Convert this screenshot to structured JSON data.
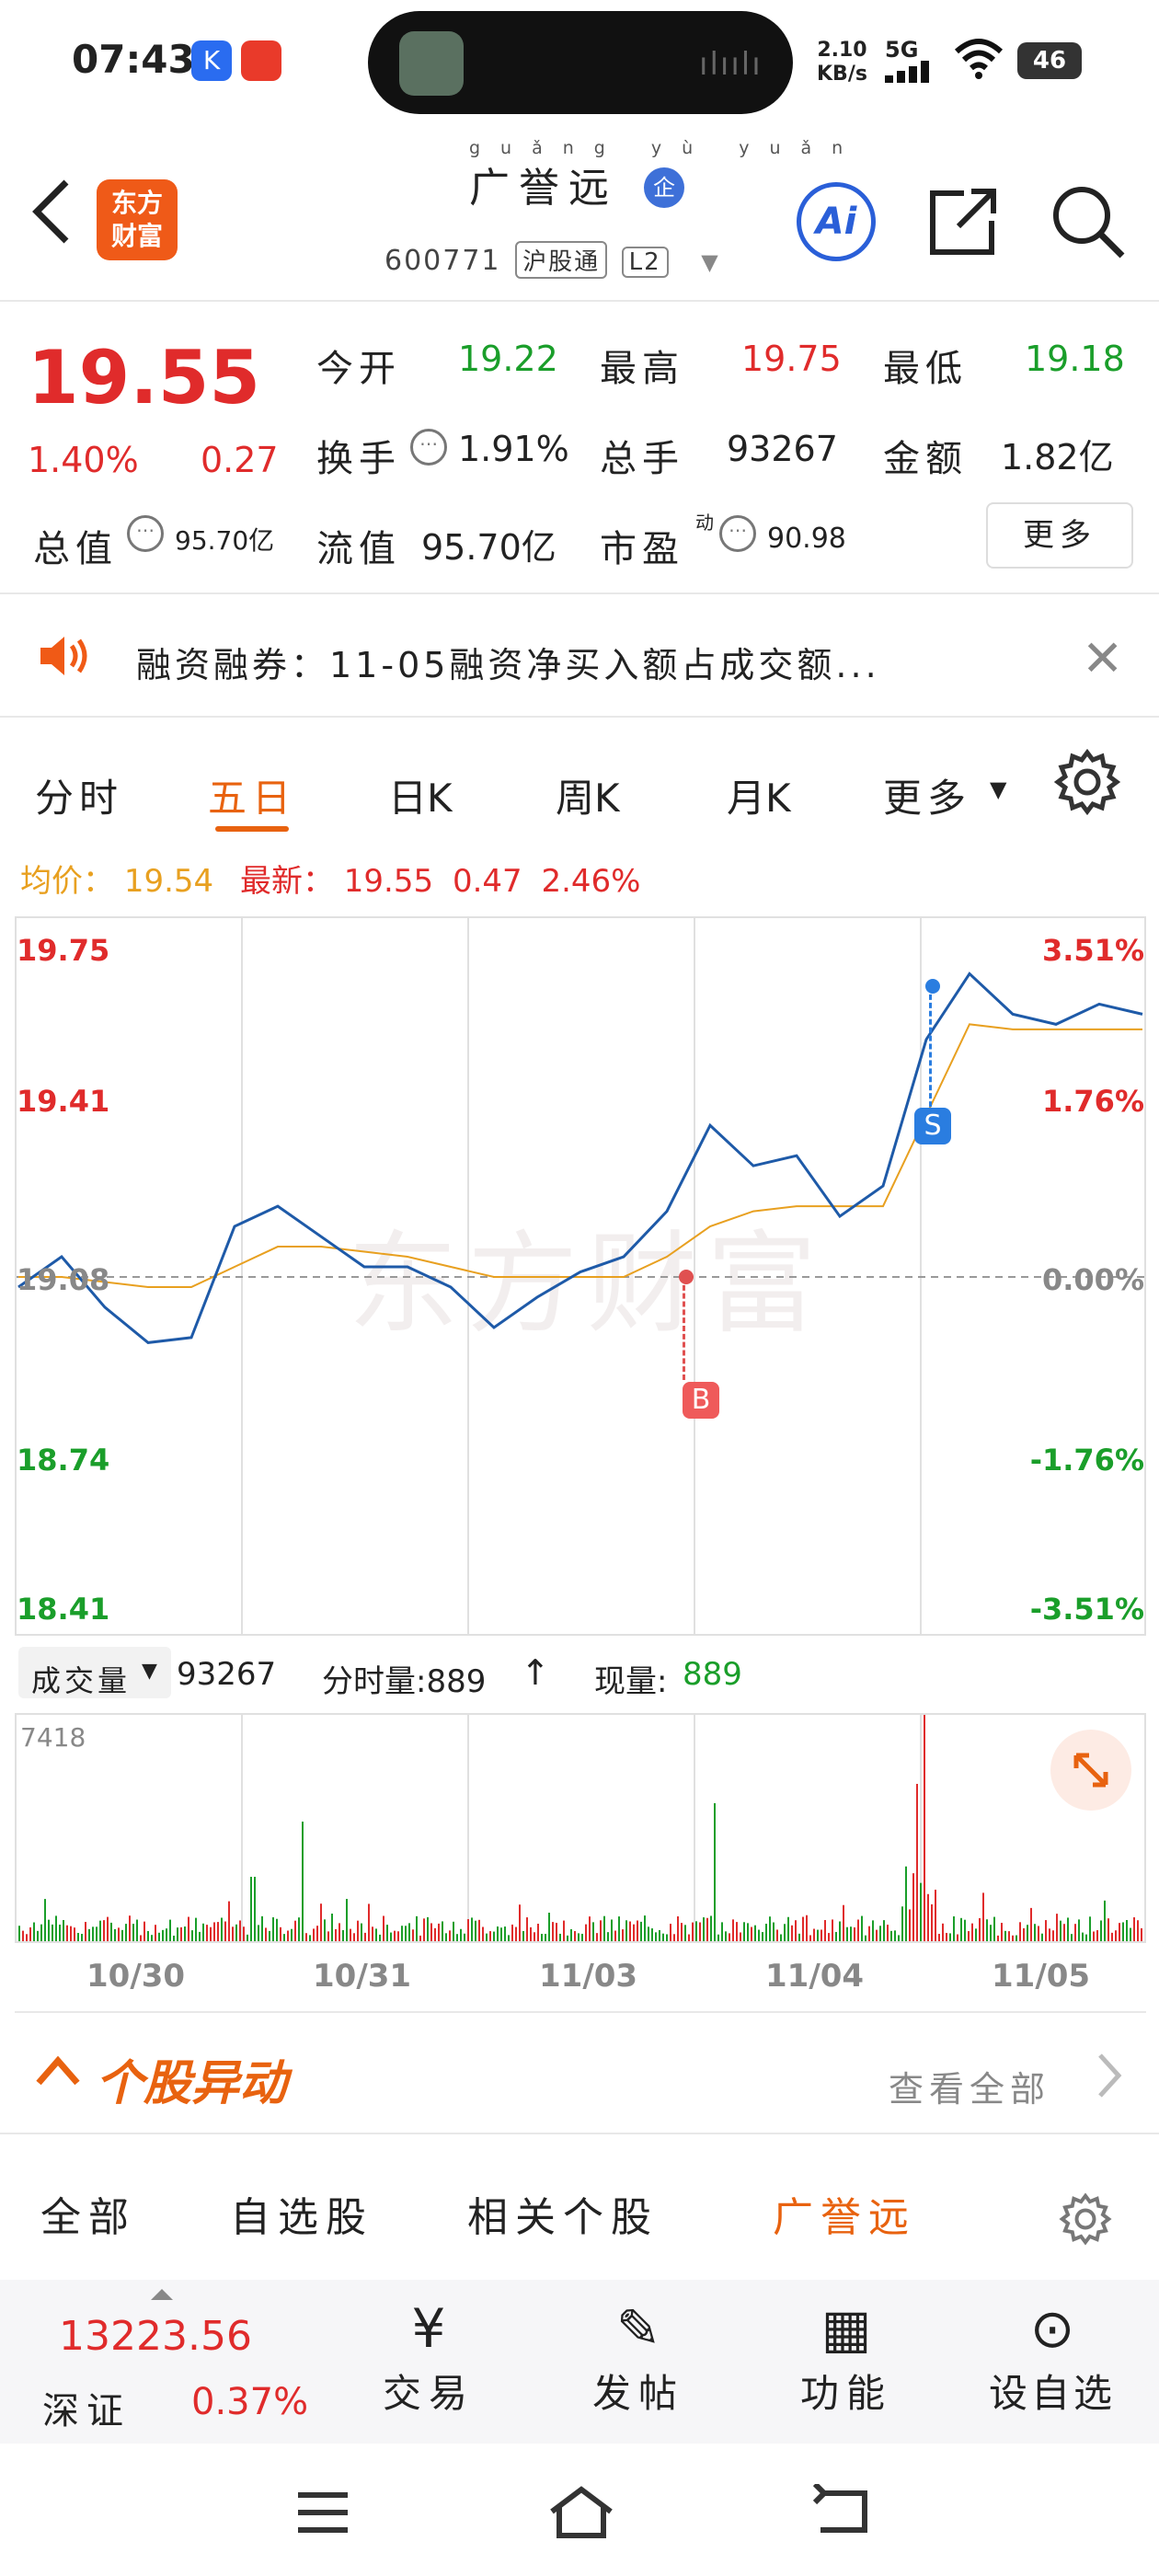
{
  "status": {
    "time": "07:43",
    "net_speed": "2.10",
    "net_unit": "KB/s",
    "signal": "5G",
    "battery": "46"
  },
  "header": {
    "logo_line1": "东方",
    "logo_line2": "财富",
    "stock_name": "广誉远",
    "stock_name_pinyin": [
      "guǎng",
      "yù",
      "yuǎn"
    ],
    "badge": "企",
    "stock_code": "600771",
    "tags": [
      "沪股通",
      "L2"
    ],
    "ai_label": "Ai"
  },
  "quote": {
    "price": "19.55",
    "change_pct": "1.40%",
    "change": "0.27",
    "open_label": "今开",
    "open": "19.22",
    "high_label": "最高",
    "high": "19.75",
    "low_label": "最低",
    "low": "19.18",
    "turnover_label": "换手",
    "turnover": "1.91%",
    "volume_label": "总手",
    "volume": "93267",
    "amount_label": "金额",
    "amount": "1.82亿",
    "total_mv_label": "总值",
    "total_mv": "95.70亿",
    "float_mv_label": "流值",
    "float_mv": "95.70亿",
    "pe_label": "市盈",
    "pe_sup": "动",
    "pe": "90.98",
    "more_label": "更多"
  },
  "notice": {
    "text": "融资融券：11-05融资净买入额占成交额..."
  },
  "tabs": {
    "items": [
      "分时",
      "五日",
      "日K",
      "周K",
      "月K",
      "更多"
    ],
    "active": "五日"
  },
  "price_info": {
    "avg_label": "均价：",
    "avg": "19.54",
    "latest_label": "最新：",
    "latest": "19.55",
    "latest_change": "0.47",
    "latest_pct": "2.46%"
  },
  "chart_data": {
    "type": "line",
    "title": "",
    "x": [
      "10/30",
      "10/31",
      "11/03",
      "11/04",
      "11/05"
    ],
    "ylim": [
      18.41,
      19.75
    ],
    "y_ticks_left": [
      "19.75",
      "19.41",
      "19.08",
      "18.74",
      "18.41"
    ],
    "y_ticks_right": [
      "3.51%",
      "1.76%",
      "0.00%",
      "-1.76%",
      "-3.51%"
    ],
    "watermark": "东方财富",
    "series": [
      {
        "name": "",
        "color": "#1e5aa8",
        "values": [
          19.06,
          19.12,
          19.02,
          18.95,
          18.96,
          19.18,
          19.22,
          19.16,
          19.1,
          19.1,
          19.06,
          18.98,
          19.04,
          19.09,
          19.12,
          19.21,
          19.38,
          19.3,
          19.32,
          19.2,
          19.26,
          19.55,
          19.68,
          19.6,
          19.58,
          19.62,
          19.6
        ]
      },
      {
        "name": "",
        "color": "#e8a020",
        "values": [
          19.08,
          19.08,
          19.07,
          19.06,
          19.06,
          19.1,
          19.14,
          19.14,
          19.13,
          19.12,
          19.1,
          19.08,
          19.08,
          19.08,
          19.08,
          19.12,
          19.18,
          19.21,
          19.22,
          19.22,
          19.22,
          19.4,
          19.58,
          19.57,
          19.57,
          19.57,
          19.57
        ]
      }
    ],
    "markers": [
      {
        "label": "B",
        "at": "11/04"
      },
      {
        "label": "S",
        "at": "11/05"
      }
    ]
  },
  "volume": {
    "label": "成交量",
    "total": "93267",
    "min_label": "分时量:889",
    "arrow": "↑",
    "cur_label": "现量:",
    "cur": "889",
    "max_tick": "7418"
  },
  "movement": {
    "title": "个股异动",
    "view_all": "查看全部",
    "filters": [
      "全部",
      "自选股",
      "相关个股",
      "广誉远"
    ],
    "active": "广誉远"
  },
  "dock": {
    "index_value": "13223.56",
    "index_name": "深证",
    "index_pct": "0.37%",
    "items": [
      "交易",
      "发帖",
      "功能",
      "设自选"
    ]
  }
}
